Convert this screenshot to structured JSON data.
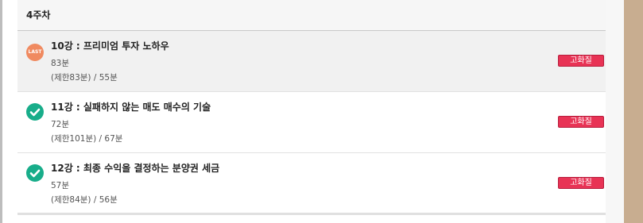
{
  "week": {
    "title": "4주차"
  },
  "lectures": [
    {
      "title": "10강 : 프리미엄 투자 노하우",
      "duration": "83분",
      "limit": "(제한83분) / 55분",
      "status_icon": "last-badge-icon",
      "status_label": "LAST",
      "quality_label": "고화질"
    },
    {
      "title": "11강 : 실패하지 않는 매도 매수의 기술",
      "duration": "72분",
      "limit": "(제한101분) / 67분",
      "status_icon": "check-circle-icon",
      "quality_label": "고화질"
    },
    {
      "title": "12강 : 최종 수익을 결정하는 분양권 세금",
      "duration": "57분",
      "limit": "(제한84분) / 56분",
      "status_icon": "check-circle-icon",
      "quality_label": "고화질"
    }
  ],
  "colors": {
    "last_badge": "#f08a60",
    "check": "#18ad8a",
    "quality_button": "#e83355"
  }
}
